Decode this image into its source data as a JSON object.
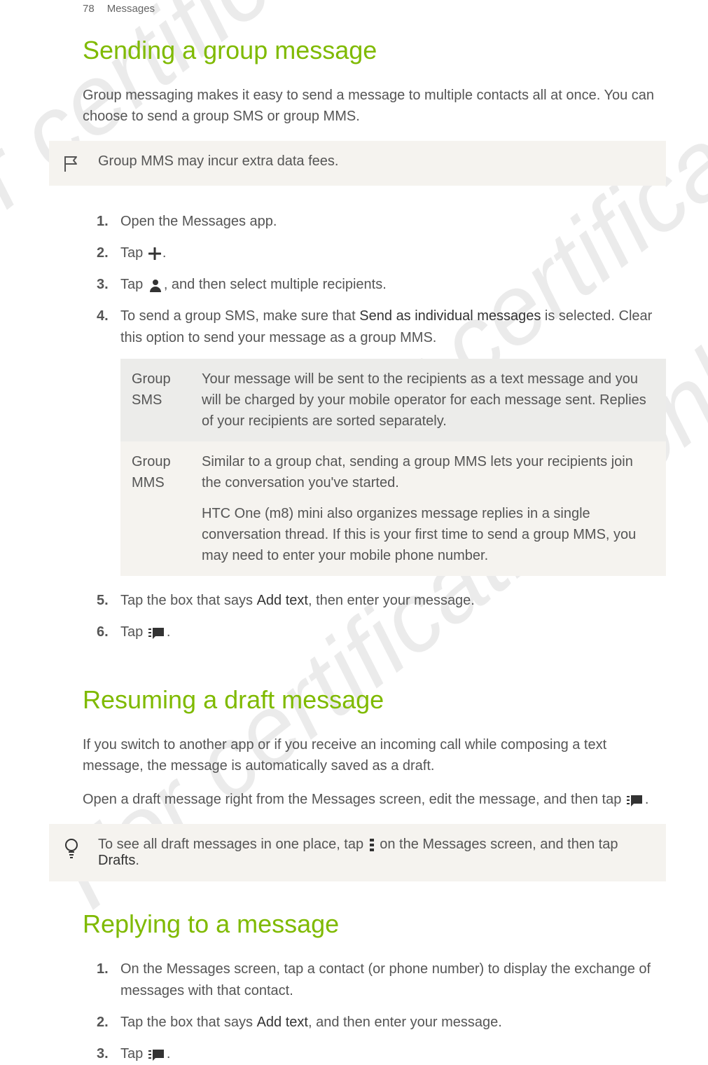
{
  "header": {
    "pageNumber": "78",
    "section": "Messages"
  },
  "h1_group": "Sending a group message",
  "group_intro": "Group messaging makes it easy to send a message to multiple contacts all at once. You can choose to send a group SMS or group MMS.",
  "note_group": "Group MMS may incur extra data fees.",
  "steps_group": {
    "s1": "Open the Messages app.",
    "s2a": "Tap ",
    "s2b": ".",
    "s3a": "Tap ",
    "s3b": ", and then select multiple recipients.",
    "s4a": "To send a group SMS, make sure that ",
    "s4bold": "Send as individual messages",
    "s4b": " is selected. Clear this option to send your message as a group MMS.",
    "s5a": "Tap the box that says ",
    "s5bold": "Add text",
    "s5b": ", then enter your message.",
    "s6a": "Tap ",
    "s6b": "."
  },
  "table": {
    "r1_label": "Group SMS",
    "r1_text": "Your message will be sent to the recipients as a text message and you will be charged by your mobile operator for each message sent. Replies of your recipients are sorted separately.",
    "r2_label": "Group MMS",
    "r2_text1": "Similar to a group chat, sending a group MMS lets your recipients join the conversation you've started.",
    "r2_text2": "HTC One (m8) mini also organizes message replies in a single conversation thread. If this is your first time to send a group MMS, you may need to enter your mobile phone number."
  },
  "h1_draft": "Resuming a draft message",
  "draft_p1": "If you switch to another app or if you receive an incoming call while composing a text message, the message is automatically saved as a draft.",
  "draft_p2a": "Open a draft message right from the Messages screen, edit the message, and then tap ",
  "draft_p2b": ".",
  "tip_a": "To see all draft messages in one place, tap ",
  "tip_b": " on the Messages screen, and then tap ",
  "tip_bold": "Drafts",
  "tip_c": ".",
  "h1_reply": "Replying to a message",
  "steps_reply": {
    "s1": "On the Messages screen, tap a contact (or phone number) to display the exchange of messages with that contact.",
    "s2a": "Tap the box that says ",
    "s2bold": "Add text",
    "s2b": ", and then enter your message.",
    "s3a": "Tap ",
    "s3b": "."
  }
}
